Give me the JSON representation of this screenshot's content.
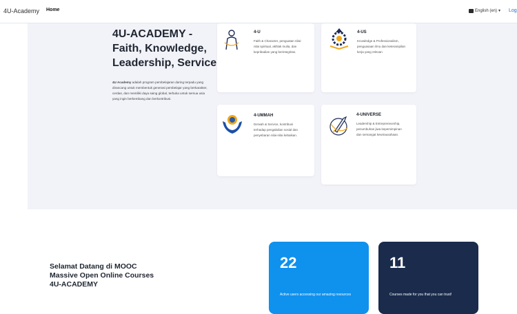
{
  "navbar": {
    "brand": "4U-Academy",
    "home": "Home",
    "language": "English (en)",
    "login": "Log"
  },
  "hero": {
    "title": "4U-ACADEMY - Faith, Knowledge, Leadership, Service",
    "desc_brand": "4U Academy",
    "description": " adalah program pembelajaran daring terpadu yang dirancang untuk membentuk generasi pembelajar yang berkarakter, cerdas, dan memiliki daya saing global, terbuka untuk semua usia yang ingin berkembang dan berkontribusi."
  },
  "cards": [
    {
      "title": "4-U",
      "text": "Faith & Character, penguatan nilai-nilai spiritual, akhlak mulia, dan kepribadian yang berintegritas."
    },
    {
      "title": "4-US",
      "text": "Knowledge & Professionalism, penguasaan ilmu dan keterampilan kerja yang relevan"
    },
    {
      "title": "4-UMMAH",
      "text": "Da'wah & Service, kontribusi terhadap pengabdian sosial dan penyebaran nilai-nilai kebaikan."
    },
    {
      "title": "4-UNIVERSE",
      "text": "Leadership & Entrepreneurship, penumbuhan jiwa kepemimpinan dan semangat kewirausahaan."
    }
  ],
  "welcome": {
    "line1": "Selamat Datang di MOOC",
    "line2": "Massive Open Online Courses",
    "line3": "4U-ACADEMY"
  },
  "stats": [
    {
      "value": "22",
      "text": "Active users accessing our amazing resources"
    },
    {
      "value": "11",
      "text": "Courses made for you that you can trust!"
    }
  ],
  "colors": {
    "blue": "#0f91ee",
    "navy": "#1a2b4c",
    "hero_bg": "#f2f3f8"
  }
}
